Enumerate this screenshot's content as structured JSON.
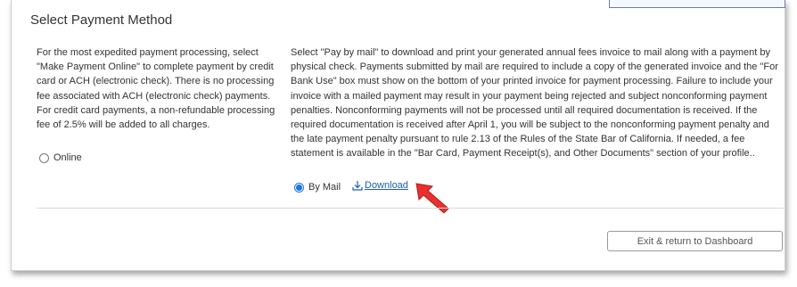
{
  "section": {
    "title": "Select Payment Method"
  },
  "online_option": {
    "description": "For the most expedited payment processing, select \"Make Payment Online\" to complete payment by credit card or ACH (electronic check). There is no processing fee associated with ACH (electronic check) payments. For credit card payments, a non-refundable processing fee of 2.5% will be added to all charges.",
    "label": "Online",
    "selected": false
  },
  "mail_option": {
    "description": "Select \"Pay by mail\" to download and print your generated annual fees invoice to mail along with a payment by physical check. Payments submitted by mail are required to include a copy of the generated invoice and the \"For Bank Use\" box must show on the bottom of your printed invoice for payment processing. Failure to include your invoice with a mailed payment may result in your payment being rejected and subject nonconforming payment penalties. Nonconforming payments will not be processed until all required documentation is received. If the required documentation is received after April 1, you will be subject to the nonconforming payment penalty and the late payment penalty pursuant to rule 2.13 of the Rules of the State Bar of California. If needed, a fee statement is available in the \"Bar Card, Payment Receipt(s), and Other Documents\" section of your profile..",
    "label": "By Mail",
    "selected": true,
    "download_label": "Download",
    "download_icon": "download-icon"
  },
  "footer": {
    "exit_button_label": "Exit & return to Dashboard"
  },
  "colors": {
    "link": "#1a5fb4",
    "radio_selected": "#1a73e8",
    "annotation_arrow": "#e8302c"
  }
}
